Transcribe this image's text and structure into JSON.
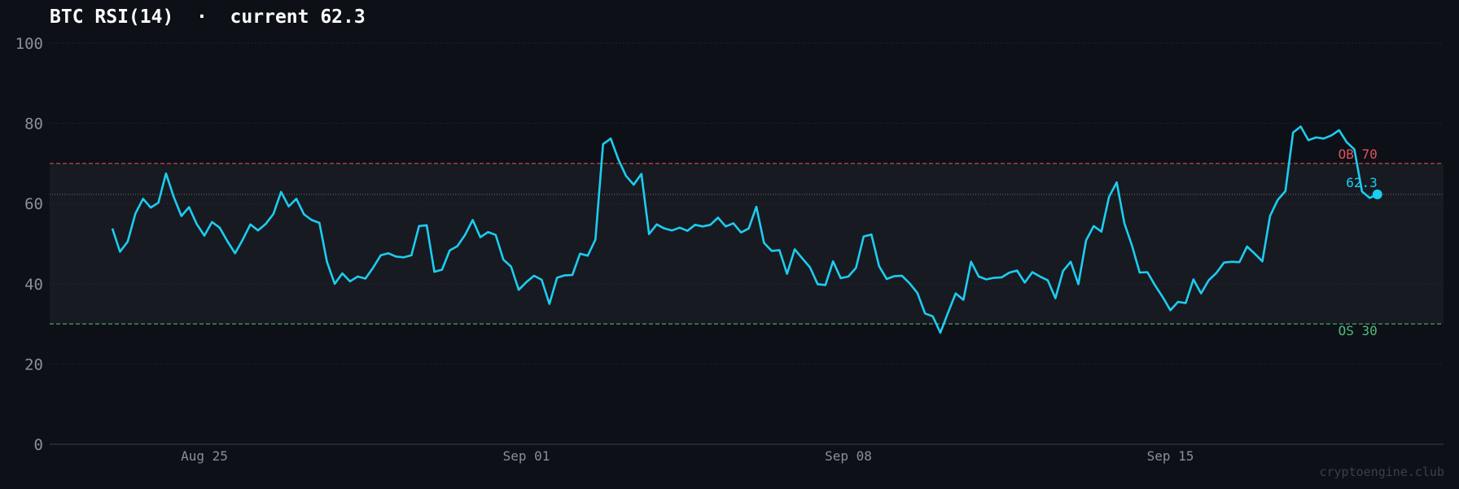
{
  "title": "BTC RSI(14)  ·  current 62.3",
  "watermark": "cryptoengine.club",
  "colors": {
    "background": "#0d1017",
    "line": "#1ccdf0",
    "overbought": "#e2505e",
    "oversold": "#4fbd7a",
    "band_fill": "#171a21",
    "grid": "#2a2e36",
    "tick": "#8a8f98"
  },
  "chart_data": {
    "type": "line",
    "title": "BTC RSI(14)  ·  current 62.3",
    "xlabel": "",
    "ylabel": "",
    "ylim": [
      0,
      100
    ],
    "yticks": [
      "0",
      "20",
      "40",
      "60",
      "80",
      "100"
    ],
    "xticks": [
      "Aug 25",
      "Sep 01",
      "Sep 08",
      "Sep 15"
    ],
    "grid": true,
    "reference_lines": [
      {
        "label": "OB 70",
        "value": 70
      },
      {
        "label": "OS 30",
        "value": 30
      }
    ],
    "current_value": 62.3,
    "current_label": "62.3",
    "series": [
      {
        "x_start": "2025-08-23",
        "step_hours": 4,
        "values": [
          53.8,
          48,
          50.5,
          57.5,
          61.2,
          59,
          60.2,
          67.5,
          61.7,
          56.9,
          59.1,
          54.9,
          52,
          55.4,
          54,
          50.6,
          47.6,
          51,
          54.8,
          53.3,
          54.9,
          57.4,
          62.9,
          59.3,
          61.2,
          57.3,
          55.9,
          55.2,
          45.4,
          40,
          42.6,
          40.6,
          41.8,
          41.3,
          44,
          47.1,
          47.6,
          46.8,
          46.6,
          47.1,
          54.4,
          54.6,
          43,
          43.5,
          48.3,
          49.4,
          52.2,
          55.9,
          51.6,
          52.9,
          52.2,
          46,
          44.3,
          38.5,
          40.4,
          42,
          41,
          35,
          41.5,
          42.1,
          42.2,
          47.5,
          47,
          51,
          74.8,
          76.2,
          71,
          66.9,
          64.7,
          67.4,
          52.4,
          54.8,
          53.8,
          53.3,
          54,
          53.2,
          54.7,
          54.3,
          54.7,
          56.5,
          54.3,
          55.1,
          52.8,
          53.8,
          59.2,
          50.2,
          48.2,
          48.4,
          42.5,
          48.6,
          46.3,
          44.1,
          39.9,
          39.7,
          45.6,
          41.4,
          41.8,
          44,
          51.8,
          52.3,
          44.4,
          41.2,
          41.9,
          42,
          40.1,
          37.7,
          32.6,
          31.9,
          27.8,
          32.8,
          37.6,
          36,
          45.5,
          41.8,
          41.1,
          41.5,
          41.6,
          42.8,
          43.3,
          40.3,
          42.9,
          41.8,
          40.9,
          36.4,
          43.2,
          45.5,
          39.9,
          50.8,
          54.4,
          53,
          61.7,
          65.3,
          55.1,
          49.5,
          42.8,
          42.9,
          39.6,
          36.7,
          33.4,
          35.5,
          35.2,
          41.1,
          37.6,
          40.9,
          42.7,
          45.3,
          45.5,
          45.4,
          49.3,
          47.5,
          45.6,
          56.9,
          60.9,
          63.1,
          77.7,
          79.2,
          75.8,
          76.5,
          76.2,
          77,
          78.3,
          75.3,
          73.5,
          63,
          61.4,
          62.3
        ]
      }
    ]
  }
}
